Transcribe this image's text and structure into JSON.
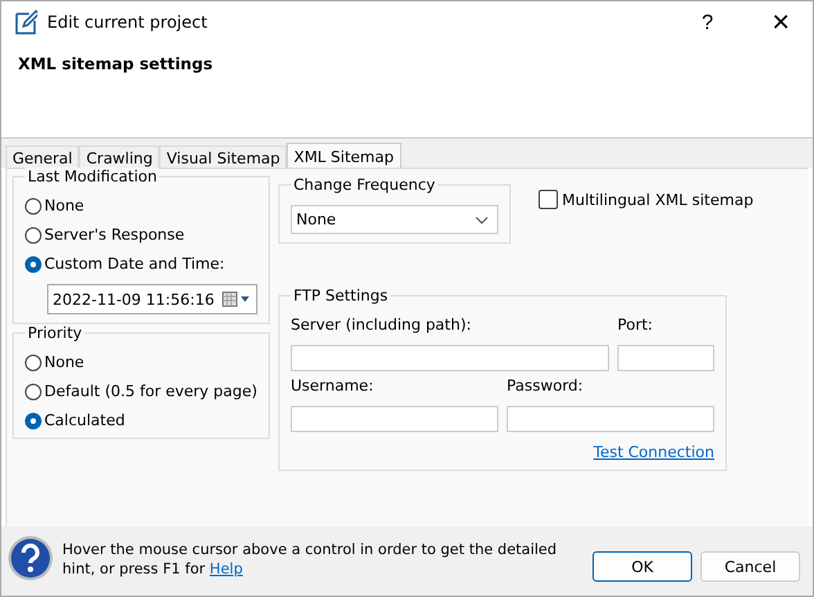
{
  "window": {
    "title": "Edit current project",
    "help_button": "?",
    "close_button": "×"
  },
  "header": {
    "title": "XML sitemap settings"
  },
  "tabs": [
    {
      "label": "General",
      "selected": false
    },
    {
      "label": "Crawling",
      "selected": false
    },
    {
      "label": "Visual Sitemap",
      "selected": false
    },
    {
      "label": "XML Sitemap",
      "selected": true
    }
  ],
  "last_modification": {
    "title": "Last Modification",
    "options": [
      {
        "label": "None",
        "selected": false
      },
      {
        "label": "Server's Response",
        "selected": false
      },
      {
        "label": "Custom Date and Time:",
        "selected": true
      }
    ],
    "date_value": "2022-11-09 11:56:16"
  },
  "priority": {
    "title": "Priority",
    "options": [
      {
        "label": "None",
        "selected": false
      },
      {
        "label": "Default (0.5 for every page)",
        "selected": false
      },
      {
        "label": "Calculated",
        "selected": true
      }
    ]
  },
  "change_frequency": {
    "title": "Change Frequency",
    "value": "None"
  },
  "multilingual": {
    "label": "Multilingual XML sitemap",
    "checked": false
  },
  "ftp": {
    "title": "FTP Settings",
    "server_label": "Server (including path):",
    "port_label": "Port:",
    "username_label": "Username:",
    "password_label": "Password:",
    "test_link": "Test Connection"
  },
  "footer": {
    "hint": "Hover the mouse cursor above a control in order to get the detailed hint, or press F1 for",
    "hint_link": "Help",
    "buttons": [
      {
        "label": "OK",
        "kind": "default"
      },
      {
        "label": "Cancel",
        "kind": "normal"
      }
    ]
  }
}
